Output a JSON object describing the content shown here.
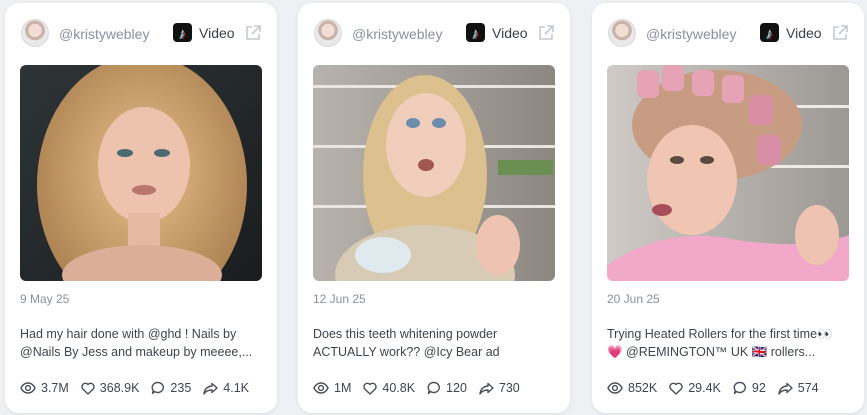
{
  "cards": [
    {
      "handle": "@kristywebley",
      "platform_label": "Video",
      "platform_icon": "tiktok-icon",
      "date": "9 May 25",
      "caption_line1": "Had my hair done with @ghd ! Nails by",
      "caption_line2": "@Nails By Jess and makeup by meeee,...",
      "views": "3.7M",
      "likes": "368.9K",
      "comments": "235",
      "shares": "4.1K"
    },
    {
      "handle": "@kristywebley",
      "platform_label": "Video",
      "platform_icon": "tiktok-icon",
      "date": "12 Jun 25",
      "caption_line1": "Does this teeth whitening powder",
      "caption_line2": "ACTUALLY work?? @Icy Bear ad",
      "views": "1M",
      "likes": "40.8K",
      "comments": "120",
      "shares": "730"
    },
    {
      "handle": "@kristywebley",
      "platform_label": "Video",
      "platform_icon": "tiktok-icon",
      "date": "20 Jun 25",
      "caption_line1": "Trying Heated Rollers for the first time👀",
      "caption_line2": "💗 @REMINGTON™ UK 🇬🇧 rollers...",
      "views": "852K",
      "likes": "29.4K",
      "comments": "92",
      "shares": "574"
    }
  ],
  "colors": {
    "background": "#eef0f4",
    "card": "#ffffff",
    "muted_text": "#8a8fa0",
    "body_text": "#3f4350"
  }
}
